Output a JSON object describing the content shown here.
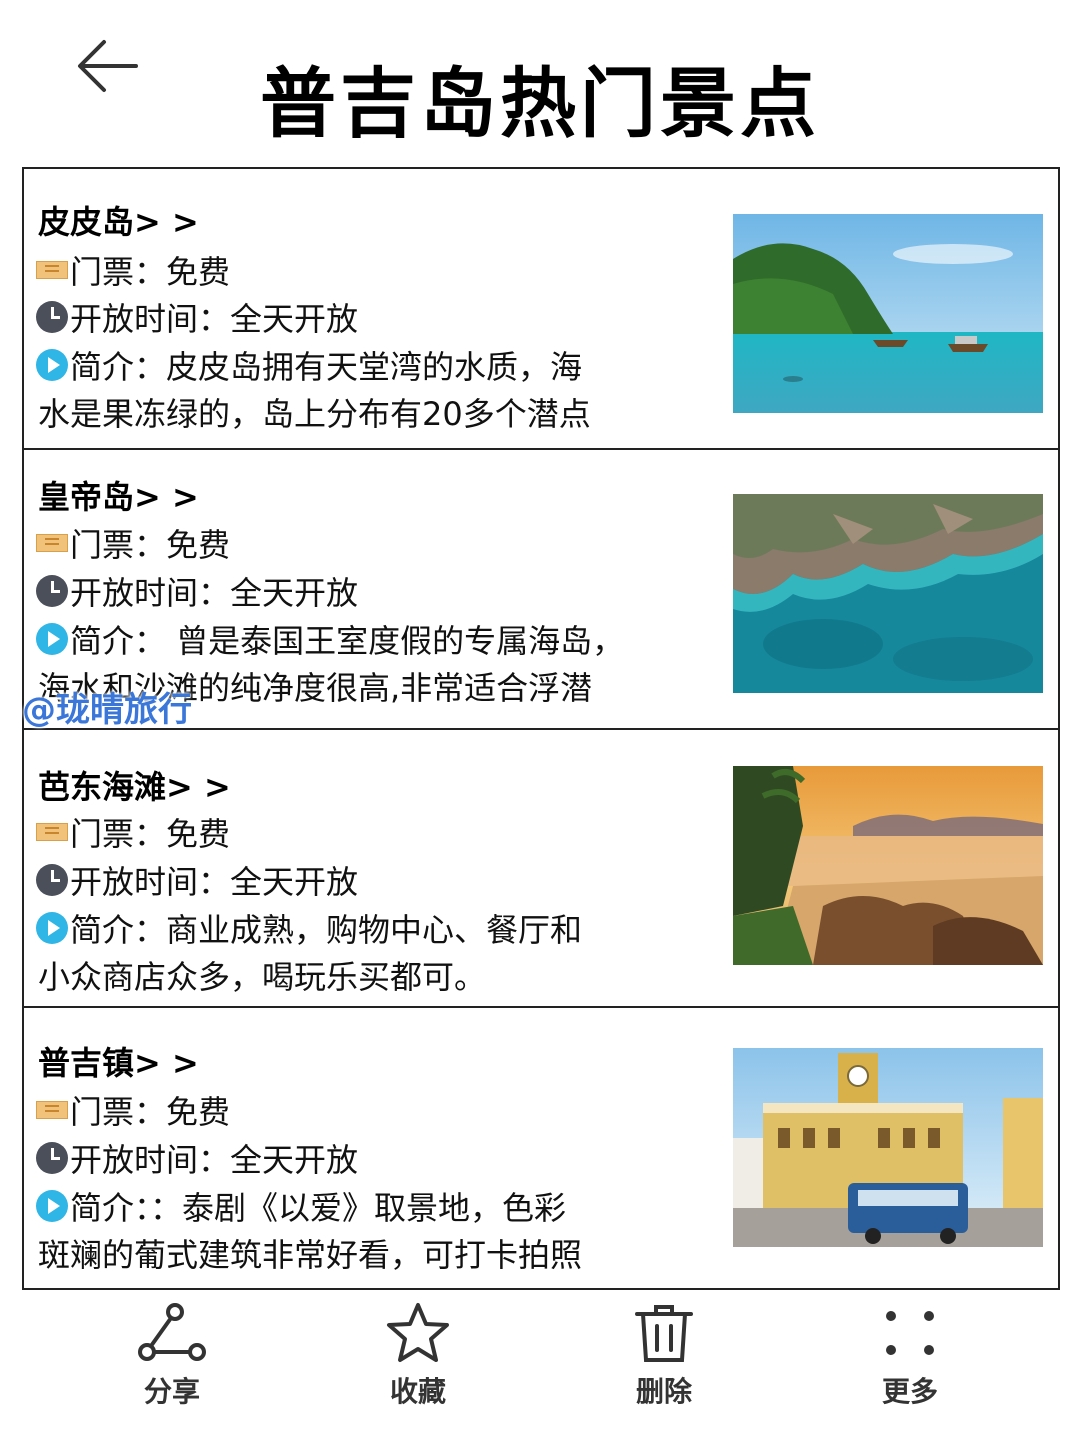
{
  "header": {
    "title": "普吉岛热门景点",
    "back_icon": "arrow-left-icon"
  },
  "spots": [
    {
      "title": "皮皮岛> >",
      "ticket": "门票：免费",
      "hours": "开放时间：全天开放",
      "intro_line1": "简介：皮皮岛拥有天堂湾的水质，海",
      "intro_line2": "水是果冻绿的，岛上分布有20多个潜点"
    },
    {
      "title": "皇帝岛> >",
      "ticket": "门票：免费",
      "hours": "开放时间：全天开放",
      "intro_line1": "简介： 曾是泰国王室度假的专属海岛，",
      "intro_line2": "海水和沙滩的纯净度很高,非常适合浮潜"
    },
    {
      "title": "芭东海滩> >",
      "ticket": "门票：免费",
      "hours": "开放时间：全天开放",
      "intro_line1": "简介：商业成熟，购物中心、餐厅和",
      "intro_line2": "小众商店众多，喝玩乐买都可。"
    },
    {
      "title": "普吉镇> >",
      "ticket": "门票：免费",
      "hours": "开放时间：全天开放",
      "intro_line1": "简介：：泰剧《以爱》取景地，色彩",
      "intro_line2": "斑斓的葡式建筑非常好看，可打卡拍照"
    }
  ],
  "watermark": "@珑晴旅行",
  "bottom_nav": [
    {
      "label": "分享",
      "icon": "share-icon"
    },
    {
      "label": "收藏",
      "icon": "star-icon"
    },
    {
      "label": "删除",
      "icon": "trash-icon"
    },
    {
      "label": "更多",
      "icon": "more-dots-icon"
    }
  ]
}
